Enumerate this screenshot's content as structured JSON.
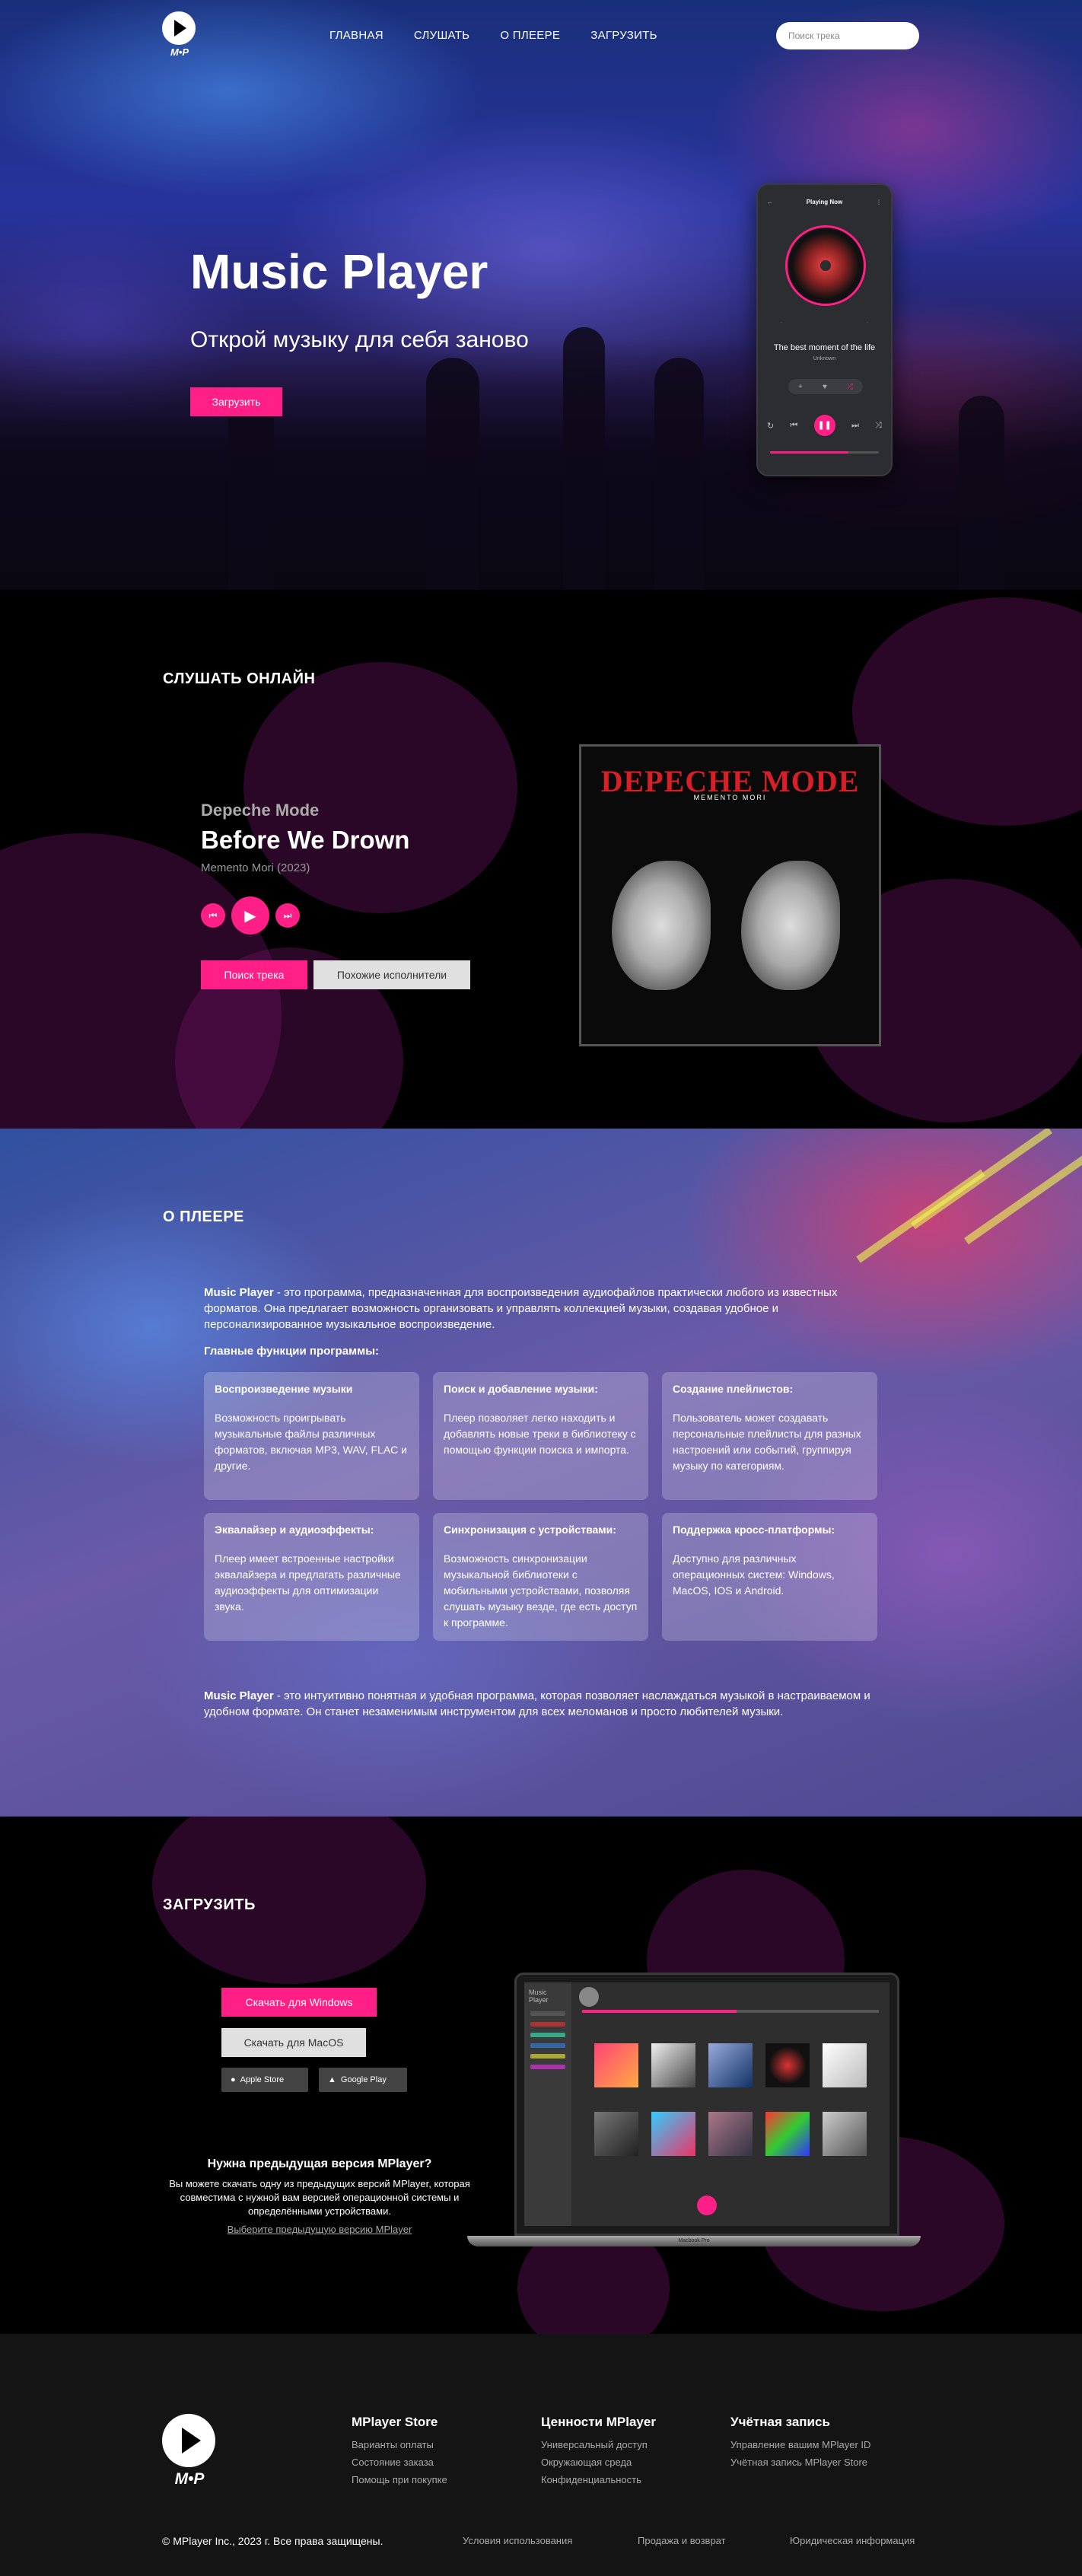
{
  "nav": {
    "logo_text": "M•P",
    "links": [
      "ГЛАВНАЯ",
      "СЛУШАТЬ",
      "О ПЛЕЕРЕ",
      "ЗАГРУЗИТЬ"
    ],
    "search_placeholder": "Поиск трека"
  },
  "hero": {
    "title": "Music Player",
    "subtitle": "Открой музыку для себя заново",
    "button": "Загрузить",
    "phone": {
      "header": "Playing Now",
      "song": "The best moment of the life",
      "artist": "Unknown",
      "progress": 0.72
    }
  },
  "listen": {
    "title": "СЛУШАТЬ ОНЛАЙН",
    "artist": "Depeche Mode",
    "track": "Before We Drown",
    "album": "Memento Mori (2023)",
    "search_button": "Поиск трека",
    "similar_button": "Похожие исполнители",
    "cover_title": "DEPECHE MODE",
    "cover_subtitle": "MEMENTO MORI"
  },
  "about": {
    "title": "О ПЛЕЕРЕ",
    "intro_bold": "Music Player",
    "intro_text": " - это программа, предназначенная для воспроизведения аудиофайлов практически любого из известных форматов. Она предлагает возможность организовать и управлять коллекцией музыки, создавая удобное и персонализированное музыкальное воспроизведение.",
    "features_heading": "Главные функции программы:",
    "cards": [
      {
        "title": "Воспроизведение музыки",
        "text": "Возможность проигрывать музыкальные файлы различных форматов, включая MP3, WAV, FLAC и другие."
      },
      {
        "title": "Поиск и добавление музыки:",
        "text": "Плеер позволяет легко находить и добавлять новые треки в библиотеку с помощью функции поиска и импорта."
      },
      {
        "title": "Создание плейлистов:",
        "text": "Пользователь может создавать персональные плейлисты для разных настроений или событий, группируя музыку по категориям."
      },
      {
        "title": "Эквалайзер и аудиоэффекты:",
        "text": "Плеер имеет встроенные настройки эквалайзера и предлагать различные аудиоэффекты для оптимизации звука."
      },
      {
        "title": "Синхронизация с устройствами:",
        "text": "Возможность синхронизации музыкальной библиотеки с мобильными устройствами, позволяя слушать музыку везде, где есть доступ к программе."
      },
      {
        "title": "Поддержка кросс-платформы:",
        "text": "Доступно для различных операционных систем: Windows, MacOS, IOS и Android."
      }
    ],
    "outro_bold": "Music Player",
    "outro_text": " - это интуитивно понятная и удобная программа, которая позволяет наслаждаться музыкой в настраиваемом и удобном формате. Он станет незаменимым инструментом для всех меломанов и просто любителей музыки."
  },
  "download": {
    "title": "ЗАГРУЗИТЬ",
    "windows": "Скачать для Windows",
    "macos": "Скачать для MacOS",
    "apple": "Apple Store",
    "google": "Google Play",
    "prev_heading": "Нужна предыдущая версия MPlayer?",
    "prev_text": "Вы можете скачать одну из предыдущих версий MPlayer, которая совместима с нужной вам версией операционной системы и определёнными устройствами.",
    "prev_link": "Выберите предыдущую версию MPlayer",
    "laptop_app_title": "Music Player",
    "laptop_label": "Macbook Pro"
  },
  "footer": {
    "logo_text": "M•P",
    "columns": [
      {
        "title": "MPlayer Store",
        "links": [
          "Варианты оплаты",
          "Состояние заказа",
          "Помощь при покупке"
        ]
      },
      {
        "title": "Ценности MPlayer",
        "links": [
          "Универсальный доступ",
          "Окружающая среда",
          "Конфиденциальность"
        ]
      },
      {
        "title": "Учётная запись",
        "links": [
          "Управление вашим MPlayer ID",
          "Учётная запись MPlayer Store"
        ]
      }
    ],
    "copyright": "© MPlayer Inc., 2023 г. Все права защищены.",
    "bottom_links": [
      "Условия использования",
      "Продажа и возврат",
      "Юридическая информация"
    ]
  },
  "colors": {
    "accent": "#ff1f86",
    "background": "#000000",
    "footer": "#141414"
  }
}
